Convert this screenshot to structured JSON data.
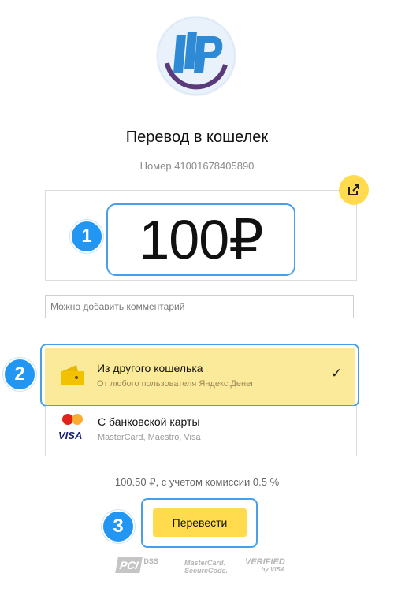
{
  "header": {
    "title": "Перевод в кошелек",
    "wallet_number": "Номер 41001678405890"
  },
  "amount": {
    "value": "100",
    "currency": "₽"
  },
  "comment": {
    "placeholder": "Можно добавить комментарий"
  },
  "payment_options": [
    {
      "title": "Из другого кошелька",
      "subtitle": "От любого пользователя Яндекс.Денег",
      "selected": true
    },
    {
      "title": "С банковской карты",
      "subtitle": "MasterCard, Maestro, Visa",
      "selected": false
    }
  ],
  "commission": {
    "text": "100.50  ₽, с учетом комиссии 0.5 %"
  },
  "submit": {
    "label": "Перевести"
  },
  "annotations": [
    "1",
    "2",
    "3"
  ],
  "card_logos": {
    "maestro_text": "Maestro Card",
    "visa": "VISA"
  },
  "security": {
    "pci": "PCI",
    "dss": "DSS",
    "mastercard": "MasterCard.",
    "securecode": "SecureCode.",
    "verified": "VERIFIED",
    "by_visa": "by VISA"
  },
  "colors": {
    "accent_yellow": "#ffdb4d",
    "selected_bg": "#fcea9b",
    "highlight_blue": "#4a9fe7",
    "badge_blue": "#2196f3"
  }
}
